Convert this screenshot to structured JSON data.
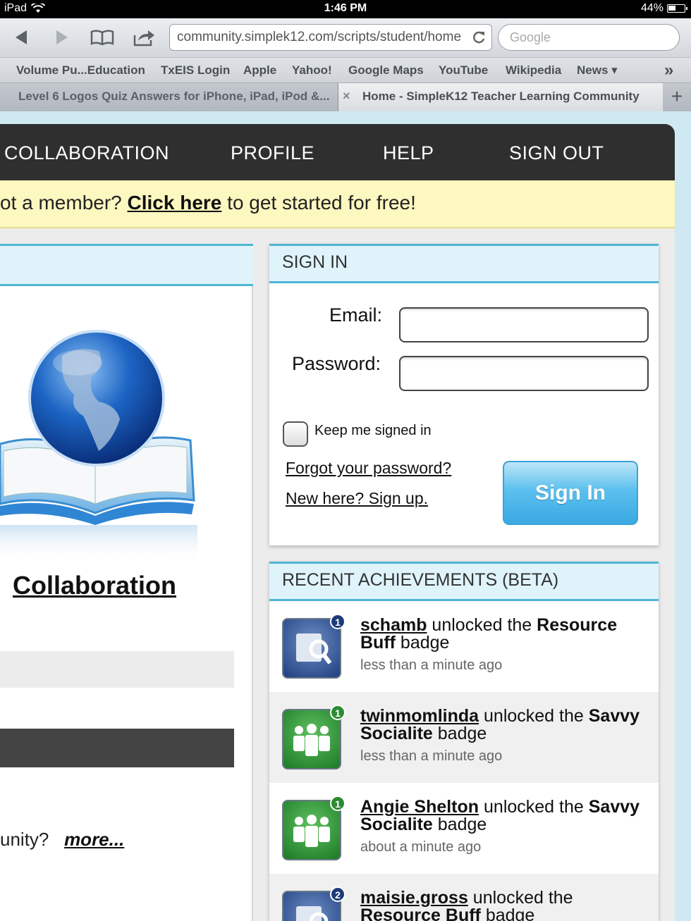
{
  "status": {
    "device": "iPad",
    "time": "1:46 PM",
    "battery": "44%"
  },
  "browser": {
    "url": "community.simplek12.com/scripts/student/home",
    "search_placeholder": "Google",
    "bookmarks": [
      "Volume Pu...Education",
      "TxEIS Login",
      "Apple",
      "Yahoo!",
      "Google Maps",
      "YouTube",
      "Wikipedia",
      "News ▾"
    ],
    "overflow": "»",
    "tabs": [
      {
        "title": "Level 6 Logos Quiz Answers for iPhone, iPad, iPod &..."
      },
      {
        "title": "Home - SimpleK12 Teacher Learning Community",
        "close": "×"
      }
    ],
    "new_tab": "+"
  },
  "nav": {
    "items": [
      "COLLABORATION",
      "PROFILE",
      "HELP",
      "SIGN OUT"
    ]
  },
  "promo": {
    "prefix": "ot a member? ",
    "link": "Click here",
    "suffix": " to get started for free!"
  },
  "left": {
    "collab_title": "Collaboration",
    "more_prefix": "unity?",
    "more_link": "more..."
  },
  "signin": {
    "title": "SIGN IN",
    "email_label": "Email:",
    "password_label": "Password:",
    "keep_signed": "Keep me signed in",
    "forgot": "Forgot your password?",
    "signup": "New here? Sign up.",
    "button": "Sign In"
  },
  "achievements": {
    "title": "RECENT ACHIEVEMENTS (BETA)",
    "items": [
      {
        "user": "schamb",
        "verb": " unlocked the ",
        "badge": "Resource Buff",
        "tail": " badge",
        "time": "less than a minute ago",
        "count": "1",
        "color": "blue"
      },
      {
        "user": "twinmomlinda",
        "verb": " unlocked the ",
        "badge": "Savvy Socialite",
        "tail": " badge",
        "time": "less than a minute ago",
        "count": "1",
        "color": "green"
      },
      {
        "user": "Angie Shelton",
        "verb": " unlocked the ",
        "badge": "Savvy Socialite",
        "tail": " badge",
        "time": "about a minute ago",
        "count": "1",
        "color": "green"
      },
      {
        "user": "maisie.gross",
        "verb": " unlocked the ",
        "badge": "Resource Buff",
        "tail": " badge",
        "time": "",
        "count": "2",
        "color": "blue"
      }
    ]
  }
}
